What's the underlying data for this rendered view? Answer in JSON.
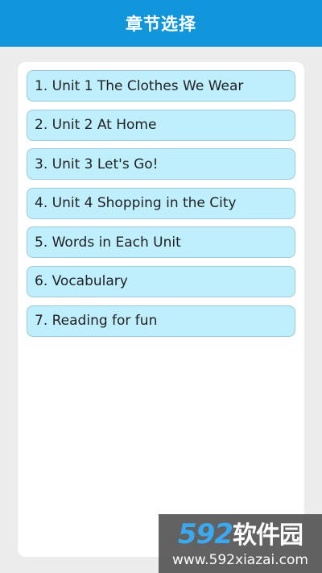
{
  "header": {
    "title": "章节选择"
  },
  "chapters": [
    {
      "label": "1. Unit 1 The Clothes We Wear"
    },
    {
      "label": "2. Unit 2 At Home"
    },
    {
      "label": "3. Unit 3 Let's Go!"
    },
    {
      "label": "4. Unit 4 Shopping in the City"
    },
    {
      "label": "5. Words in Each Unit"
    },
    {
      "label": "6. Vocabulary"
    },
    {
      "label": "7. Reading for fun"
    }
  ],
  "watermark": {
    "number": "592",
    "text": "软件园",
    "url": "www.592xiazai.com"
  },
  "colors": {
    "header": "#1296db",
    "item_bg": "#bfeefd",
    "item_border": "#9cc9d8",
    "page_bg": "#ececec"
  }
}
